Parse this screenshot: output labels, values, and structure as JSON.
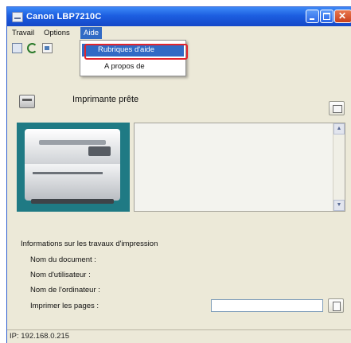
{
  "window": {
    "title": "Canon LBP7210C"
  },
  "menubar": {
    "items": [
      "Travail",
      "Options",
      "Aide"
    ]
  },
  "menu_aide": {
    "items": [
      "Rubriques d'aide",
      "A propos de"
    ]
  },
  "printer": {
    "status": "Imprimante prête"
  },
  "job_info": {
    "title": "Informations sur les travaux d'impression",
    "document_name_label": "Nom du document :",
    "user_name_label": "Nom d'utilisateur :",
    "computer_name_label": "Nom de l'ordinateur :",
    "print_pages_label": "Imprimer les pages :",
    "print_pages_value": ""
  },
  "statusbar": {
    "text": "IP: 192.168.0.215"
  },
  "colors": {
    "titlebar": "#1c5ee0",
    "menu_highlight": "#316ac5",
    "callout_red": "#e2242d"
  }
}
